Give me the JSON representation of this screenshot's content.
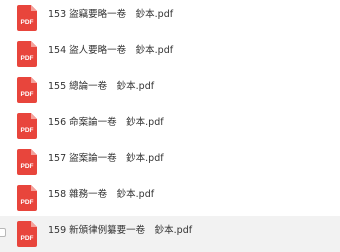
{
  "colors": {
    "pdf_icon_red": "#e8453c",
    "pdf_icon_text": "#ffffff",
    "text": "#333333",
    "hover_bg": "#f2f2f2"
  },
  "icon": {
    "name": "pdf-file-icon",
    "label": "PDF"
  },
  "files": [
    {
      "name": "153 盜竊要略一卷　鈔本.pdf"
    },
    {
      "name": "154 盜人要略一卷　鈔本.pdf"
    },
    {
      "name": "155 總論一卷　鈔本.pdf"
    },
    {
      "name": "156 命案論一卷　鈔本.pdf"
    },
    {
      "name": "157 盜案論一卷　鈔本.pdf"
    },
    {
      "name": "158 雜務一卷　鈔本.pdf"
    },
    {
      "name": "159 新頒律例纂要一卷　鈔本.pdf"
    }
  ]
}
